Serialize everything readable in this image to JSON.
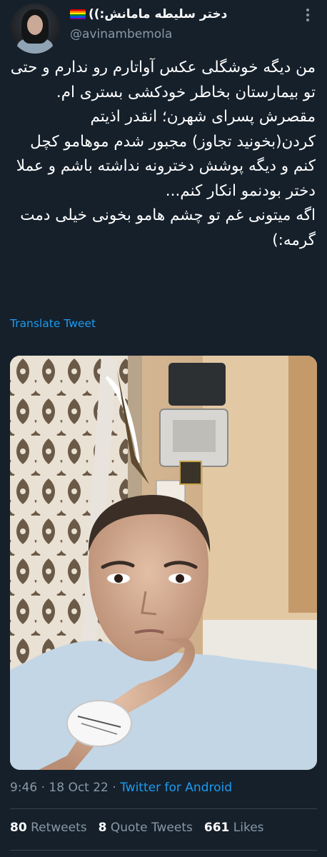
{
  "author": {
    "display_name": "دختر سلیطه مامانش:))",
    "handle": "@avinambemola",
    "flag_icon": "rainbow-flag-icon"
  },
  "tweet": {
    "paragraphs": [
      "من دیگه خوشگلی عکس آواتارم رو ندارم و حتی تو بیمارستان بخاطر خودکشی بستری ام.",
      "مقصرش پسرای شهرن؛ انقدر اذیتم کردن(بخونید تجاوز) مجبور شدم موهامو کچل کنم و دیگه پوشش دخترونه نداشته باشم و عملا دختر بودنمو انکار کنم...",
      "اگه میتونی غم تو چشم هامو بخونی خیلی دمت گرمه:)"
    ],
    "translate_label": "Translate Tweet"
  },
  "meta": {
    "time": "9:46",
    "separator": "·",
    "date": "18 Oct 22",
    "source": "Twitter for Android"
  },
  "stats": {
    "retweets_count": "80",
    "retweets_label": "Retweets",
    "quotes_count": "8",
    "quotes_label": "Quote Tweets",
    "likes_count": "661",
    "likes_label": "Likes"
  },
  "colors": {
    "background": "#15202b",
    "accent": "#1d9bf0",
    "secondary_text": "#8899a6",
    "divider": "#38444d"
  }
}
